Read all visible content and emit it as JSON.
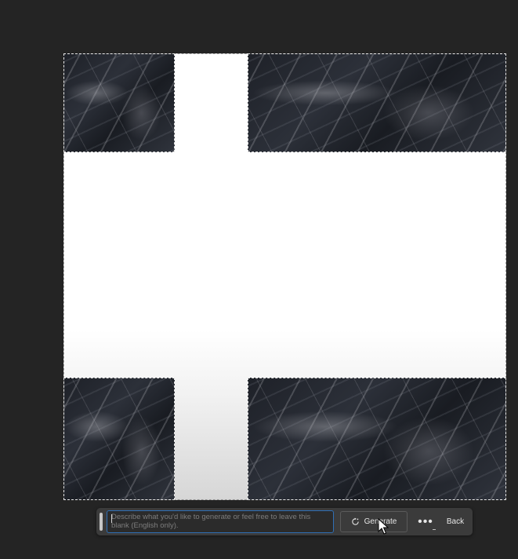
{
  "app": {
    "background_color": "#242424",
    "accent_color": "#2f6fb5"
  },
  "canvas": {
    "description_regions": [
      "marble-tl",
      "marble-tr",
      "marble-bl",
      "marble-br"
    ],
    "fill_color": "#ffffff"
  },
  "contextual_taskbar": {
    "prompt": {
      "placeholder": "Describe what you'd like to generate or feel free to leave this blank (English only).",
      "value": ""
    },
    "generate_label": "Generate",
    "generate_icon": "refresh-sparkle-icon",
    "more_icon": "more-dots-icon",
    "more_label": "•••",
    "back_label": "Back"
  }
}
